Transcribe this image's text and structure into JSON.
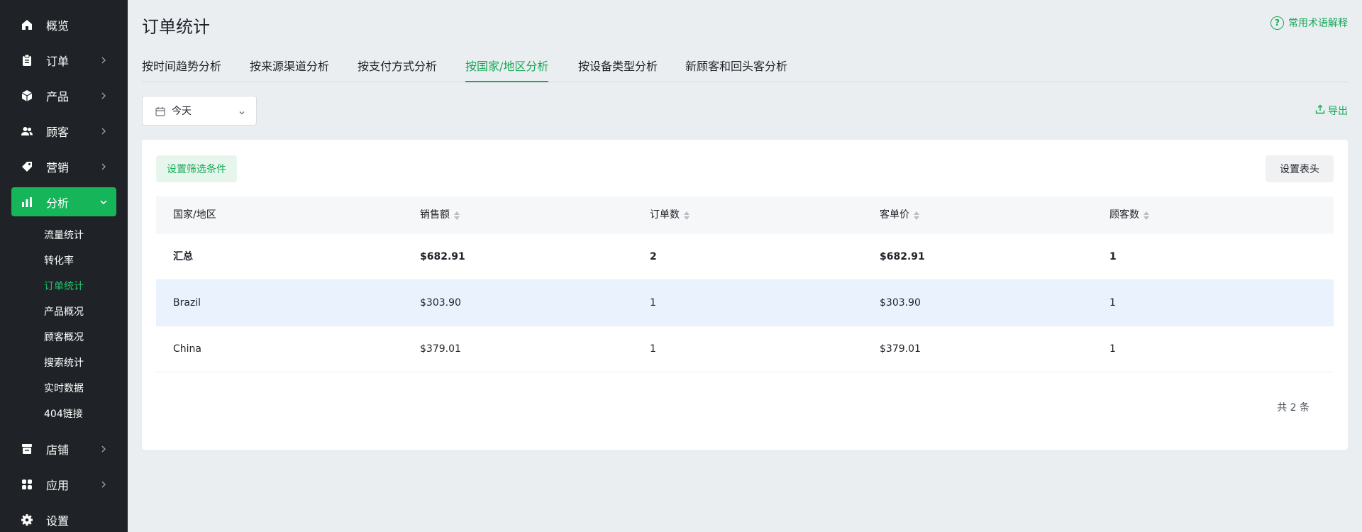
{
  "sidebar": {
    "items": [
      {
        "label": "概览",
        "icon": "home-icon",
        "chevron": false
      },
      {
        "label": "订单",
        "icon": "clipboard-icon",
        "chevron": true
      },
      {
        "label": "产品",
        "icon": "box-icon",
        "chevron": true
      },
      {
        "label": "顾客",
        "icon": "users-icon",
        "chevron": true
      },
      {
        "label": "营销",
        "icon": "tag-icon",
        "chevron": true
      },
      {
        "label": "分析",
        "icon": "bar-chart-icon",
        "chevron": true,
        "active": true
      },
      {
        "label": "店铺",
        "icon": "store-icon",
        "chevron": true
      },
      {
        "label": "应用",
        "icon": "apps-icon",
        "chevron": true
      },
      {
        "label": "设置",
        "icon": "gear-icon",
        "chevron": false
      }
    ],
    "sub_items": [
      "流量统计",
      "转化率",
      "订单统计",
      "产品概况",
      "顾客概况",
      "搜索统计",
      "实时数据",
      "404链接"
    ],
    "active_sub": "订单统计"
  },
  "header": {
    "title": "订单统计",
    "help_label": "常用术语解释"
  },
  "tabs": [
    "按时间趋势分析",
    "按来源渠道分析",
    "按支付方式分析",
    "按国家/地区分析",
    "按设备类型分析",
    "新顾客和回头客分析"
  ],
  "active_tab": "按国家/地区分析",
  "date_picker": {
    "value": "今天"
  },
  "export_label": "导出",
  "toolbar": {
    "filter_label": "设置筛选条件",
    "header_label": "设置表头"
  },
  "table": {
    "columns": [
      "国家/地区",
      "销售额",
      "订单数",
      "客单价",
      "顾客数"
    ],
    "summary": [
      "汇总",
      "$682.91",
      "2",
      "$682.91",
      "1"
    ],
    "rows": [
      [
        "Brazil",
        "$303.90",
        "1",
        "$303.90",
        "1"
      ],
      [
        "China",
        "$379.01",
        "1",
        "$379.01",
        "1"
      ]
    ]
  },
  "pagination": {
    "total_text": "共 2 条"
  },
  "colors": {
    "accent": "#16a957",
    "sidebar_bg": "#1f2327",
    "active_nav": "#16b55a",
    "highlight_row": "#eaf3fd"
  }
}
